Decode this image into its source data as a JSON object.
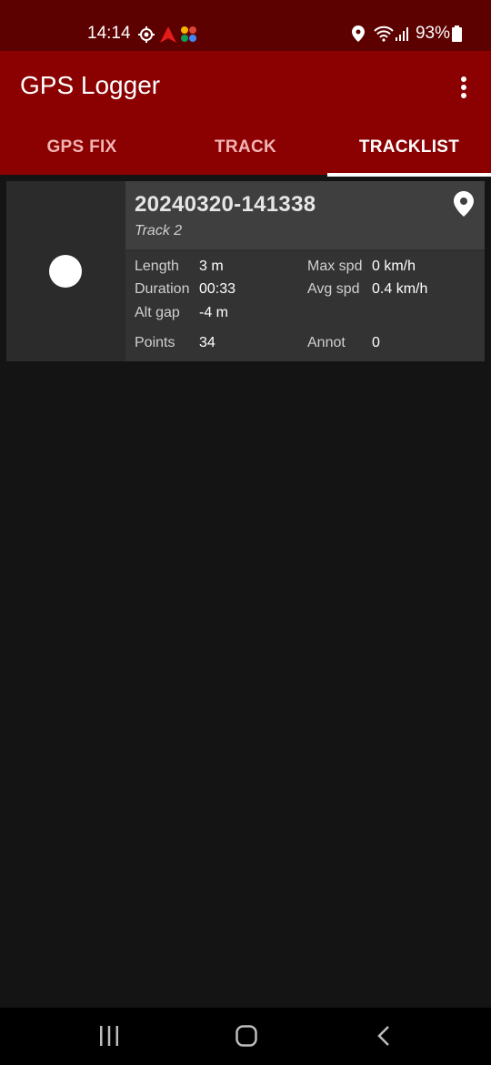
{
  "status_bar": {
    "time": "14:14",
    "battery": "93%"
  },
  "app": {
    "title": "GPS Logger"
  },
  "tabs": [
    {
      "label": "GPS FIX",
      "active": false
    },
    {
      "label": "TRACK",
      "active": false
    },
    {
      "label": "TRACKLIST",
      "active": true
    }
  ],
  "track": {
    "name": "20240320-141338",
    "description": "Track 2",
    "stats": {
      "length_label": "Length",
      "length_value": "3 m",
      "duration_label": "Duration",
      "duration_value": "00:33",
      "altgap_label": "Alt gap",
      "altgap_value": "-4 m",
      "points_label": "Points",
      "points_value": "34",
      "maxspd_label": "Max spd",
      "maxspd_value": "0 km/h",
      "avgspd_label": "Avg spd",
      "avgspd_value": "0.4 km/h",
      "annot_label": "Annot",
      "annot_value": "0"
    }
  },
  "colors": {
    "status_bar": "#5c0000",
    "app_bar": "#8b0000",
    "background": "#141414"
  },
  "icons": [
    "gps-status-icon",
    "navigation-arrow-icon",
    "photos-app-icon",
    "location-icon",
    "wifi-icon",
    "signal-icon",
    "battery-icon",
    "overflow-menu-icon",
    "map-pin-icon",
    "recent-apps-icon",
    "home-icon",
    "back-icon"
  ]
}
